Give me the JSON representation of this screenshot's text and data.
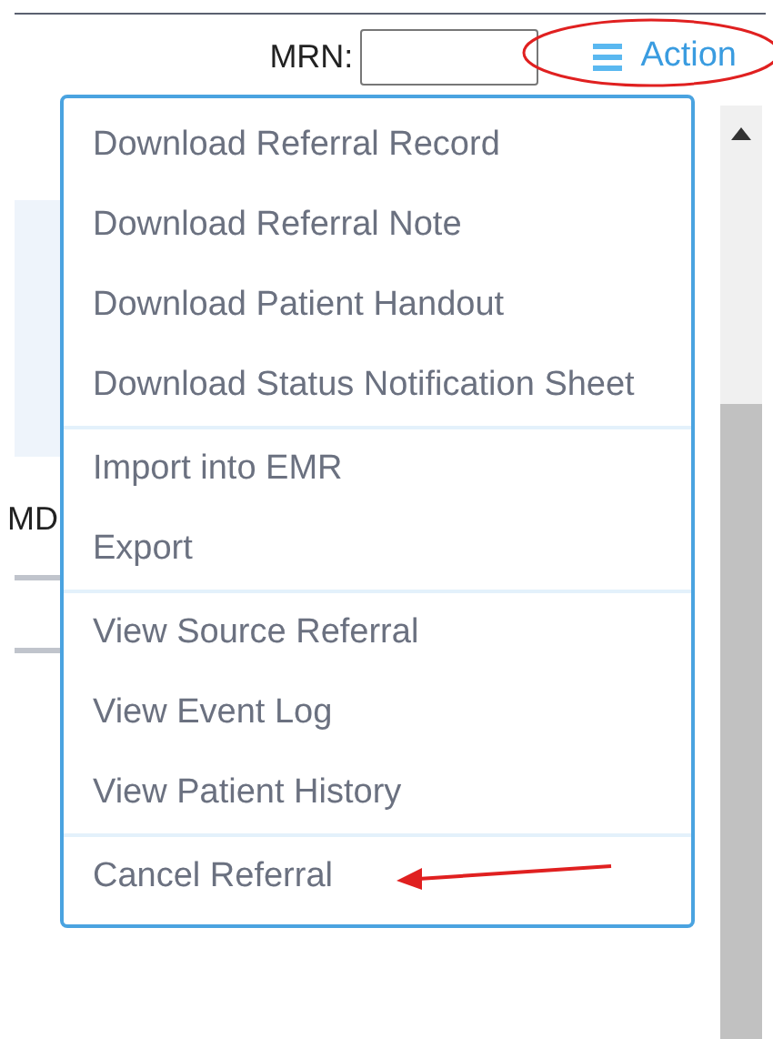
{
  "header": {
    "mrn_label": "MRN:",
    "action_label": "Action"
  },
  "background": {
    "column_label": "MD"
  },
  "action_menu": {
    "groups": [
      {
        "items": [
          "Download Referral Record",
          "Download Referral Note",
          "Download Patient Handout",
          "Download Status Notification Sheet"
        ]
      },
      {
        "items": [
          "Import into EMR",
          "Export"
        ]
      },
      {
        "items": [
          "View Source Referral",
          "View Event Log",
          "View Patient History"
        ]
      },
      {
        "items": [
          "Cancel Referral"
        ]
      }
    ]
  }
}
